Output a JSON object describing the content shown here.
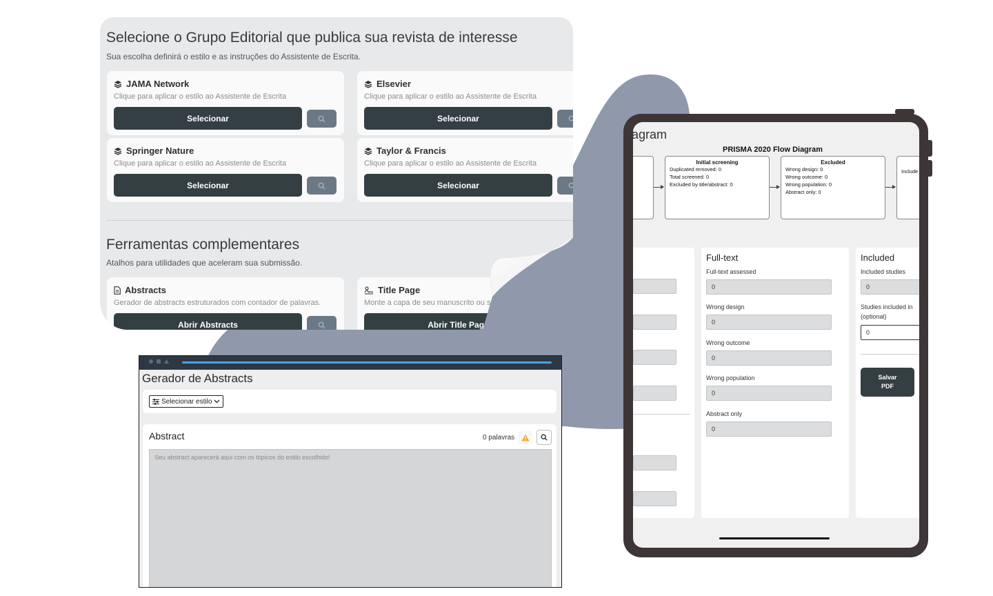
{
  "publisher_panel": {
    "title": "Selecione o Grupo Editorial que publica sua revista de interesse",
    "subtitle": "Sua escolha definirá o estilo e as instruções do Assistente de Escrita.",
    "cards": [
      {
        "name": "JAMA Network",
        "description": "Clique para aplicar o estilo ao Assistente de Escrita",
        "button": "Selecionar",
        "icon": "layers-icon"
      },
      {
        "name": "Elsevier",
        "description": "Clique para aplicar o estilo ao Assistente de Escrita",
        "button": "Selecionar",
        "icon": "layers-icon"
      },
      {
        "name": "Springer Nature",
        "description": "Clique para aplicar o estilo ao Assistente de Escrita",
        "button": "Selecionar",
        "icon": "layers-icon"
      },
      {
        "name": "Taylor & Francis",
        "description": "Clique para aplicar o estilo ao Assistente de Escrita",
        "button": "Selecionar",
        "icon": "layers-icon"
      }
    ],
    "tools_title": "Ferramentas complementares",
    "tools_subtitle": "Atalhos para utilidades que aceleram sua submissão.",
    "tools": [
      {
        "name": "Abstracts",
        "description": "Gerador de abstracts estruturados com contador de palavras.",
        "button": "Abrir Abstracts",
        "icon": "document-icon"
      },
      {
        "name": "Title Page",
        "description": "Monte a capa de seu manuscrito ou s",
        "button": "Abrir Title Page",
        "icon": "signature-icon"
      }
    ]
  },
  "abstract_panel": {
    "title": "Gerador de Abstracts",
    "style_select": "Selecionar estilo",
    "card_title": "Abstract",
    "word_count": "0 palavras",
    "placeholder": "Seu abstract aparecerá aqui com os tópicos do estilo escolhido!"
  },
  "tablet": {
    "page_title": "agram",
    "flow_title": "PRISMA 2020 Flow Diagram",
    "flow_boxes": [
      {
        "title": "Initial screening",
        "lines": [
          "Duplicated removed: 0",
          "Total screened: 0",
          "Excluded by title/abstract: 0"
        ]
      },
      {
        "title": "Excluded",
        "lines": [
          "Wrong design: 0",
          "Wrong outcome: 0",
          "Wrong population: 0",
          "Abstract only: 0"
        ]
      },
      {
        "title": "",
        "lines": [
          "Include"
        ]
      }
    ],
    "fulltext": {
      "heading": "Full-text",
      "fields": [
        {
          "label": "Full-text assessed",
          "value": "0"
        },
        {
          "label": "Wrong design",
          "value": "0"
        },
        {
          "label": "Wrong outcome",
          "value": "0"
        },
        {
          "label": "Wrong population",
          "value": "0"
        },
        {
          "label": "Abstract only",
          "value": "0"
        }
      ]
    },
    "included": {
      "heading": "Included",
      "field1_label": "Included studies",
      "field1_value": "0",
      "field2_label_1": "Studies included in",
      "field2_label_2": "(optional)",
      "field2_value": "0",
      "save_line1": "Salvar",
      "save_line2": "PDF"
    }
  },
  "colors": {
    "button_dark": "#343f44",
    "search_button": "#6b7886",
    "blob": "#8f99ab",
    "tablet_frame": "#3d3536",
    "progress_line": "#4aa3e6"
  }
}
